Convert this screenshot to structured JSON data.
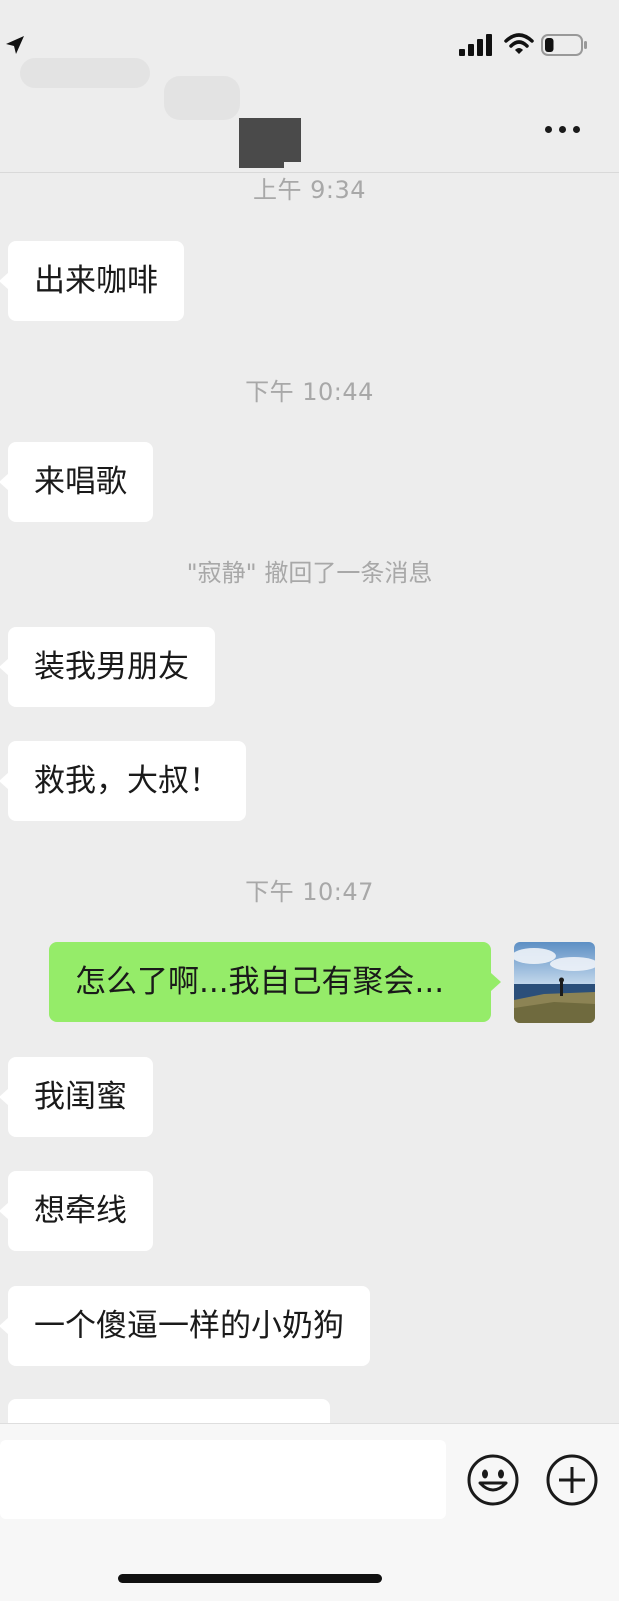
{
  "status_bar": {
    "icons": [
      "location-arrow-icon",
      "cellular-signal-icon",
      "wifi-icon",
      "battery-icon"
    ],
    "battery_level": 0.25
  },
  "nav": {
    "more_icon": "ellipsis-icon"
  },
  "messages": [
    {
      "kind": "time",
      "text": "上午 9:34"
    },
    {
      "kind": "in",
      "text": "出来咖啡"
    },
    {
      "kind": "time",
      "text": "下午 10:44"
    },
    {
      "kind": "in",
      "text": "来唱歌"
    },
    {
      "kind": "recall",
      "text": "\"寂静\" 撤回了一条消息"
    },
    {
      "kind": "in",
      "text": "装我男朋友"
    },
    {
      "kind": "in",
      "text": "救我，大叔！"
    },
    {
      "kind": "time",
      "text": "下午 10:47"
    },
    {
      "kind": "out",
      "text": "怎么了啊...我自己有聚会..."
    },
    {
      "kind": "in",
      "text": "我闺蜜"
    },
    {
      "kind": "in",
      "text": "想牵线"
    },
    {
      "kind": "in",
      "text": "一个傻逼一样的小奶狗"
    }
  ],
  "input_bar": {
    "value": "",
    "emoji_icon": "smiley-face-icon",
    "plus_icon": "plus-circle-icon"
  },
  "colors": {
    "background": "#ededed",
    "incoming_bubble": "#ffffff",
    "outgoing_bubble": "#95ec69",
    "timestamp_text": "#a8a8a8"
  }
}
